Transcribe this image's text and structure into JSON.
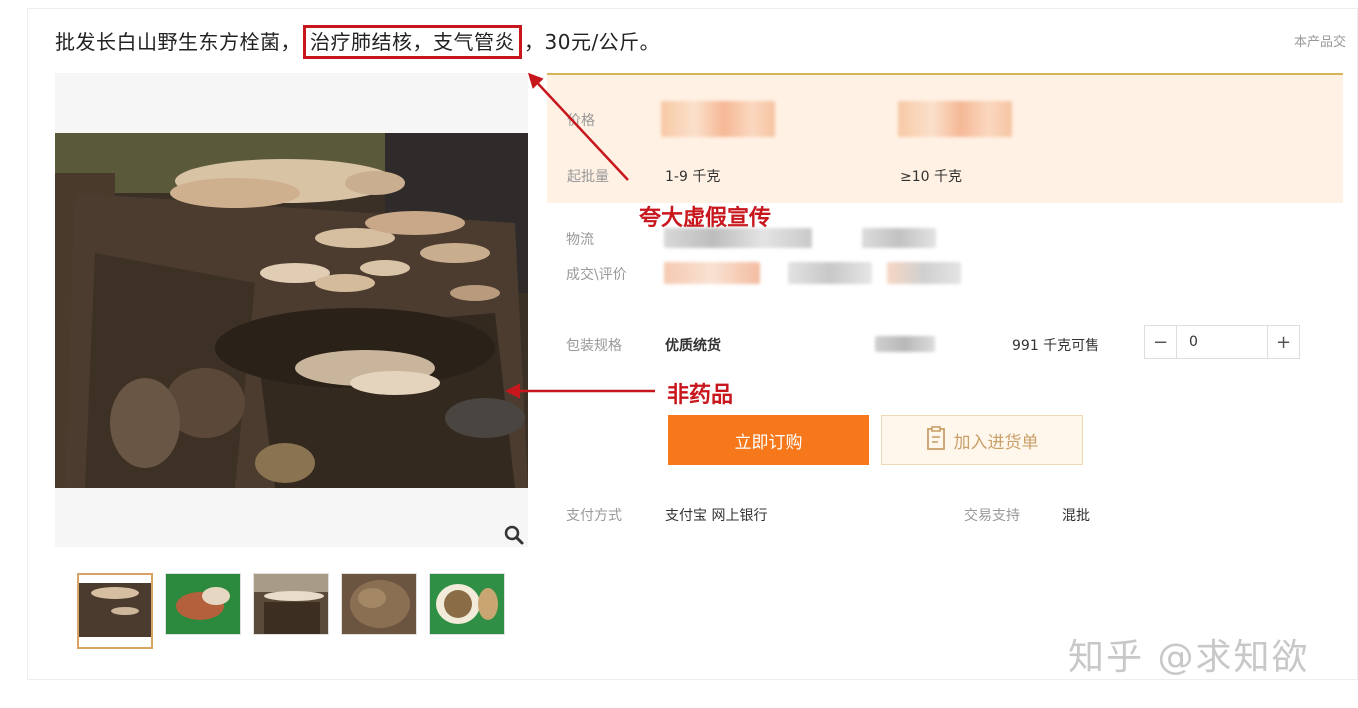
{
  "product": {
    "title_prefix": "批发长白山野生东方栓菌，",
    "title_highlight": "治疗肺结核，支气管炎",
    "title_suffix": "，30元/公斤。",
    "report_link": "本产品交"
  },
  "price_block": {
    "price_label": "价格",
    "moq_label": "起批量",
    "tier1_moq": "1-9  千克",
    "tier2_moq": "≥10  千克"
  },
  "details": {
    "logistics_label": "物流",
    "deals_label": "成交\\评价",
    "spec_label": "包装规格",
    "spec_value": "优质统货",
    "stock_text": "991 千克可售",
    "quantity_value": "0",
    "minus_symbol": "−",
    "plus_symbol": "+"
  },
  "actions": {
    "buy_now": "立即订购",
    "add_to_list": "加入进货单"
  },
  "payment": {
    "label": "支付方式",
    "methods": "支付宝  网上银行",
    "support_label": "交易支持",
    "support_value": "混批"
  },
  "annotations": {
    "false_advert": "夸大虚假宣传",
    "non_drug": "非药品",
    "color": "#c8161d"
  },
  "watermark": "知乎 @求知欲",
  "colors": {
    "buy_button": "#f6781a",
    "price_bg": "#fff1e4",
    "cart_button_bg": "#fff7ec"
  }
}
